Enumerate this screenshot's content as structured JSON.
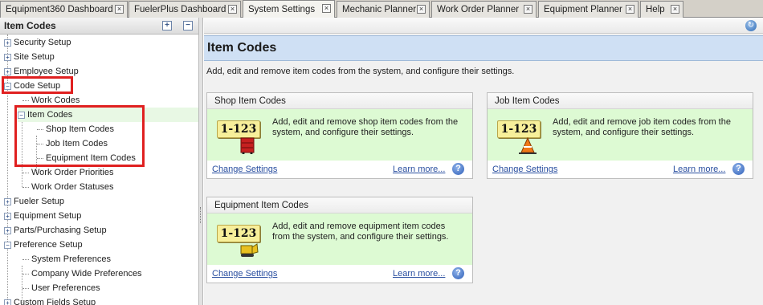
{
  "tabs": [
    {
      "label": "Equipment360 Dashboard",
      "active": false
    },
    {
      "label": "FuelerPlus Dashboard",
      "active": false
    },
    {
      "label": "System Settings",
      "active": true
    },
    {
      "label": "Mechanic Planner",
      "active": false
    },
    {
      "label": "Work Order Planner",
      "active": false
    },
    {
      "label": "Equipment Planner",
      "active": false
    },
    {
      "label": "Help",
      "active": false
    }
  ],
  "left_panel": {
    "title": "Item Codes",
    "expand_all_glyph": "+",
    "collapse_all_glyph": "−",
    "tree": [
      {
        "label": "Security Setup"
      },
      {
        "label": "Site Setup"
      },
      {
        "label": "Employee Setup"
      },
      {
        "label": "Code Setup"
      },
      {
        "label": "Work Codes"
      },
      {
        "label": "Item Codes"
      },
      {
        "label": "Shop Item Codes"
      },
      {
        "label": "Job Item Codes"
      },
      {
        "label": "Equipment Item Codes"
      },
      {
        "label": "Work Order Priorities"
      },
      {
        "label": "Work Order Statuses"
      },
      {
        "label": "Fueler Setup"
      },
      {
        "label": "Equipment Setup"
      },
      {
        "label": "Parts/Purchasing Setup"
      },
      {
        "label": "Preference Setup"
      },
      {
        "label": "System Preferences"
      },
      {
        "label": "Company Wide Preferences"
      },
      {
        "label": "User Preferences"
      },
      {
        "label": "Custom Fields Setup"
      }
    ]
  },
  "main": {
    "title": "Item Codes",
    "description": "Add, edit and remove item codes from the system, and configure their settings.",
    "cards": [
      {
        "title": "Shop Item Codes",
        "badge": "1-123",
        "text": "Add, edit and remove shop item codes from the system, and configure their settings.",
        "change_link": "Change Settings",
        "learn_link": "Learn more...",
        "help": "?"
      },
      {
        "title": "Job Item Codes",
        "badge": "1-123",
        "text": "Add, edit and remove job item codes from the system, and configure their settings.",
        "change_link": "Change Settings",
        "learn_link": "Learn more...",
        "help": "?"
      },
      {
        "title": "Equipment Item Codes",
        "badge": "1-123",
        "text": "Add, edit and remove equipment item codes from the system, and configure their settings.",
        "change_link": "Change Settings",
        "learn_link": "Learn more...",
        "help": "?"
      }
    ]
  },
  "colors": {
    "highlight_red": "#e02020",
    "title_bar_blue": "#cfe0f4",
    "card_green": "#ddfad3",
    "link_blue": "#2a4fa0"
  }
}
